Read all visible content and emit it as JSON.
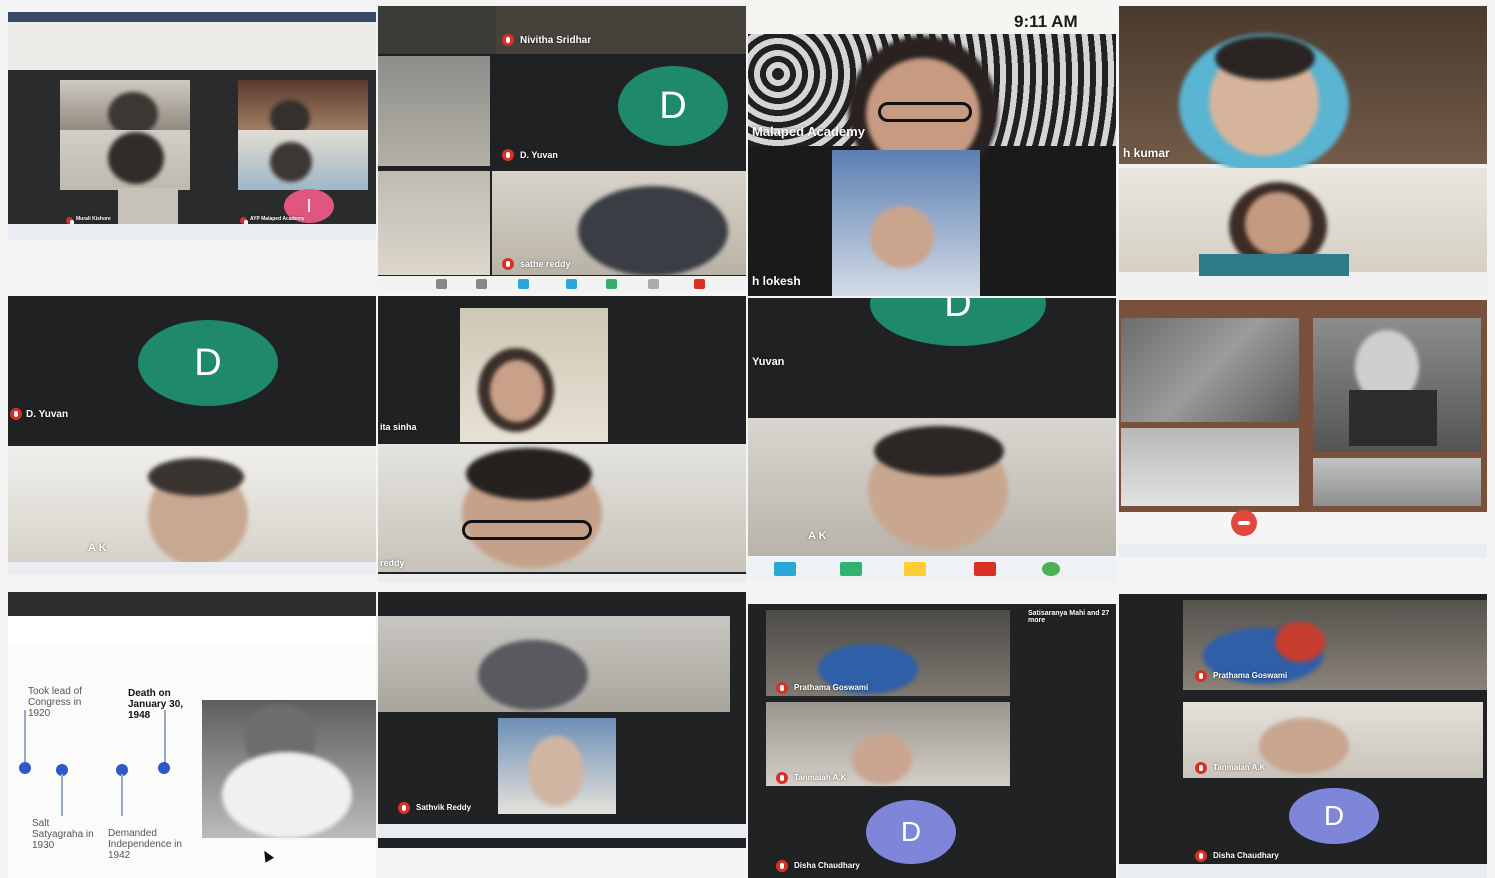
{
  "tiles": {
    "t1": {
      "avatar_letter": "I",
      "label_a": "Murali Kishore",
      "label_b": "AYP Malaped Academy"
    },
    "t2": {
      "label_top": "Nivitha Sridhar",
      "avatar_letter": "D",
      "label_mid": "D. Yuvan",
      "label_bottom": "sathe reddy"
    },
    "t3": {
      "time": "9:11 AM",
      "label_a": "Malaped Academy",
      "label_b": "h lokesh"
    },
    "t4": {
      "label_a": "h kumar"
    },
    "t5": {
      "avatar_letter": "D",
      "label_a": "D. Yuvan",
      "label_b": "A K"
    },
    "t6": {
      "label_a": "ita sinha",
      "label_b": "reddy"
    },
    "t7": {
      "avatar_letter": "D",
      "label_a": "Yuvan",
      "label_b": "A K"
    },
    "t8": {},
    "t9": {
      "events": [
        {
          "text": "Took lead of Congress in 1920",
          "bold": false
        },
        {
          "text": "Death on January 30, 1948",
          "bold": true
        },
        {
          "text": "Salt Satyagraha in 1930",
          "bold": false
        },
        {
          "text": "Demanded Independence in 1942",
          "bold": false
        }
      ]
    },
    "t10": {
      "label_a": "Sathvik Reddy"
    },
    "t11": {
      "label_top": "Satisaranya Mahi and 27 more",
      "label_a": "Prathama Goswami",
      "label_b": "Tanmaiah A.K",
      "avatar_letter": "D",
      "label_c": "Disha Chaudhary"
    },
    "t12": {
      "label_a": "Prathama Goswami",
      "label_b": "Tanmaiah A.K",
      "avatar_letter": "D",
      "label_c": "Disha Chaudhary"
    }
  },
  "colors": {
    "avatar_green": "#1f8a6a",
    "avatar_pink": "#e0567f",
    "avatar_lavender": "#7d86d9",
    "mic_red": "#d93025"
  },
  "icons": [
    "mic-off-icon",
    "end-call-icon",
    "cursor-icon",
    "taskbar-icons"
  ]
}
